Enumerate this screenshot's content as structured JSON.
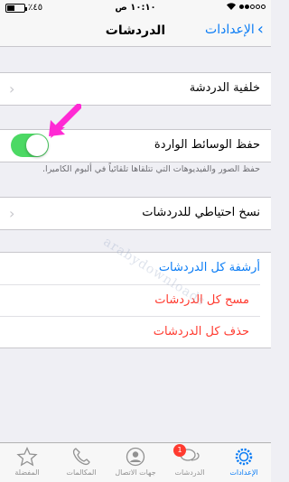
{
  "status_bar": {
    "carrier_dots": 5,
    "carrier_dots_filled": 2,
    "time": "١٠:١٠ ص",
    "battery": "٪٤٥",
    "battery_fraction": 0.45
  },
  "nav": {
    "title": "الدردشات",
    "back_label": "الإعدادات"
  },
  "rows": {
    "chat_wallpaper": "خلفية الدردشة",
    "save_incoming_media": "حفظ الوسائط الواردة",
    "save_media_enabled": true,
    "save_media_footnote": "حفظ الصور والفيديوهات التي تتلقاها تلقائياً في ألبوم الكاميرا.",
    "chat_backup": "نسخ احتياطي للدردشات",
    "archive_all": "أرشفة كل الدردشات",
    "clear_all": "مسح كل الدردشات",
    "delete_all": "حذف كل الدردشات"
  },
  "watermark": "arabydownloads",
  "colors": {
    "accent": "#0a7cf5",
    "destructive": "#ff3b30",
    "toggle_on": "#4cd964",
    "arrow": "#ff2ad4"
  },
  "tabs": [
    {
      "label": "المفضلة",
      "icon": "star-icon"
    },
    {
      "label": "المكالمات",
      "icon": "phone-icon"
    },
    {
      "label": "جهات الاتصال",
      "icon": "contacts-icon"
    },
    {
      "label": "الدردشات",
      "icon": "chats-icon",
      "badge": "1"
    },
    {
      "label": "الإعدادات",
      "icon": "settings-icon",
      "active": true
    }
  ]
}
